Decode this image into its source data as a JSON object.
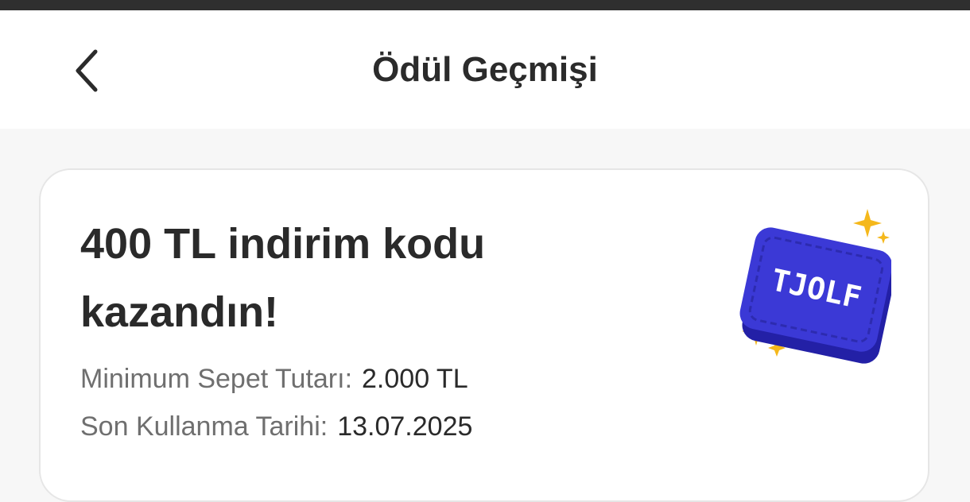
{
  "header": {
    "title": "Ödül Geçmişi"
  },
  "reward": {
    "title": "400 TL indirim kodu kazandın!",
    "min_basket_label": "Minimum Sepet Tutarı:",
    "min_basket_value": "2.000 TL",
    "expiry_label": "Son Kullanma Tarihi:",
    "expiry_value": "13.07.2025",
    "badge_text": "TJOLF"
  },
  "colors": {
    "coupon_blue": "#3b39d6",
    "sparkle": "#f5b81b",
    "title_text": "#2b2b2b",
    "label_text": "#6f6f6f"
  },
  "icons": {
    "back": "chevron-left-icon",
    "coupon": "coupon-ticket-icon",
    "sparkle": "sparkle-icon"
  }
}
